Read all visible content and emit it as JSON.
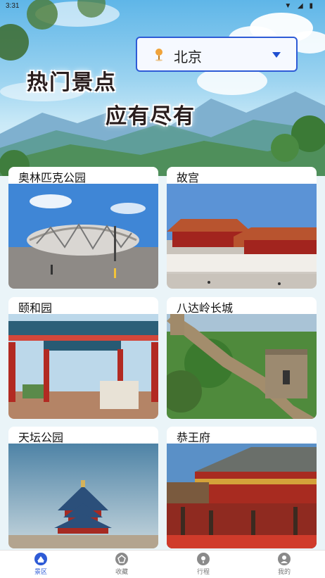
{
  "status_bar": {
    "time": "3:31",
    "icons": "▼ ◢ ▮"
  },
  "city_selector": {
    "value": "北京"
  },
  "slogan": {
    "line1": "热门景点",
    "line2": "应有尽有"
  },
  "attractions": [
    {
      "name": "奥林匹克公园",
      "icon": "birds-nest-stadium"
    },
    {
      "name": "故宫",
      "icon": "forbidden-city"
    },
    {
      "name": "颐和园",
      "icon": "summer-palace-gate"
    },
    {
      "name": "八达岭长城",
      "icon": "great-wall"
    },
    {
      "name": "天坛公园",
      "icon": "temple-of-heaven"
    },
    {
      "name": "恭王府",
      "icon": "prince-gong-mansion"
    }
  ],
  "tabs": [
    {
      "label": "景区",
      "icon": "scenic-icon",
      "active": true
    },
    {
      "label": "收藏",
      "icon": "favorites-icon",
      "active": false
    },
    {
      "label": "行程",
      "icon": "itinerary-icon",
      "active": false
    },
    {
      "label": "我的",
      "icon": "profile-icon",
      "active": false
    }
  ],
  "colors": {
    "accent": "#2e5bd6",
    "tab_inactive": "#777777"
  }
}
